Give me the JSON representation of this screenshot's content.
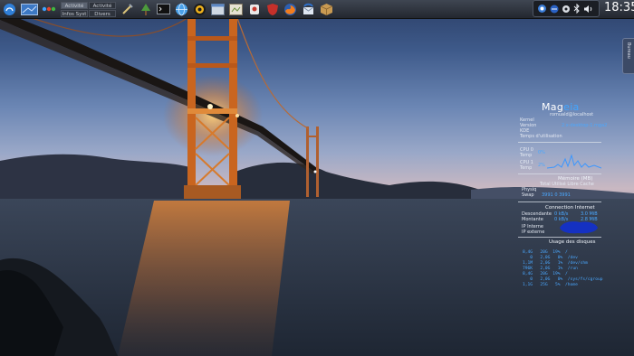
{
  "panel": {
    "pager": [
      "Activité",
      "Activité",
      "Infos Syst",
      "Divers"
    ],
    "clock": "18:35"
  },
  "icons": {
    "launchers": [
      "mageia-menu-icon",
      "show-desktop-icon",
      "app-dots-icon",
      "tools-icon",
      "tree-icon",
      "terminal-icon",
      "globe-icon",
      "sunburst-icon",
      "window-icon",
      "card-icon",
      "puzzle-icon",
      "shield-icon",
      "firefox-icon",
      "thunderbird-icon",
      "package-icon"
    ],
    "tray": [
      "network-icon",
      "blue-sphere-icon",
      "settings-icon",
      "bluetooth-icon",
      "volume-icon"
    ]
  },
  "side_tab": {
    "label": "Bureau"
  },
  "conky": {
    "logo_prefix": "Mag",
    "logo_suffix": "eia",
    "user_host": "romuald@localhost",
    "system": [
      {
        "label": "Kernel",
        "value": ""
      },
      {
        "label": "Version",
        "value": "2.x-desktop-1.mga2"
      },
      {
        "label": "KDE",
        "value": ""
      },
      {
        "label": "Temps d'utilisation",
        "value": ""
      }
    ],
    "cpu": [
      {
        "label": "CPU 0",
        "sub": "Temp",
        "value": "0%"
      },
      {
        "label": "CPU 1",
        "sub": "Temp",
        "value": "2%"
      }
    ],
    "memory": {
      "title": "Mémoire (MB)",
      "columns": "Total  Utilisé  Libre  Cache",
      "rows": [
        {
          "label": "Physiq",
          "value": ""
        },
        {
          "label": "Swap",
          "value": "3991  0  3991"
        }
      ]
    },
    "network": {
      "title": "Connection Internet",
      "rows": [
        {
          "label": "Descendante",
          "value": "0 kB/s",
          "total": "3.0 MiB"
        },
        {
          "label": "Montante",
          "value": "0 kB/s",
          "total": "2.8 MiB"
        },
        {
          "label": "IP Interne",
          "value": ""
        },
        {
          "label": "IP externe",
          "value": ""
        }
      ]
    },
    "disks": {
      "title": "Usage des disques",
      "rows": [
        "8,4G   20G  19%  /",
        "   0   2,0G   0%  /dev",
        "1,1M   2,0G   1%  /dev/shm",
        "796K   2,0G   1%  /run",
        "8,4G   20G  19%  /",
        "   0   2,0G   0%  /sys/fs/cgroup",
        "1,1G   25G   5%  /home"
      ]
    }
  }
}
